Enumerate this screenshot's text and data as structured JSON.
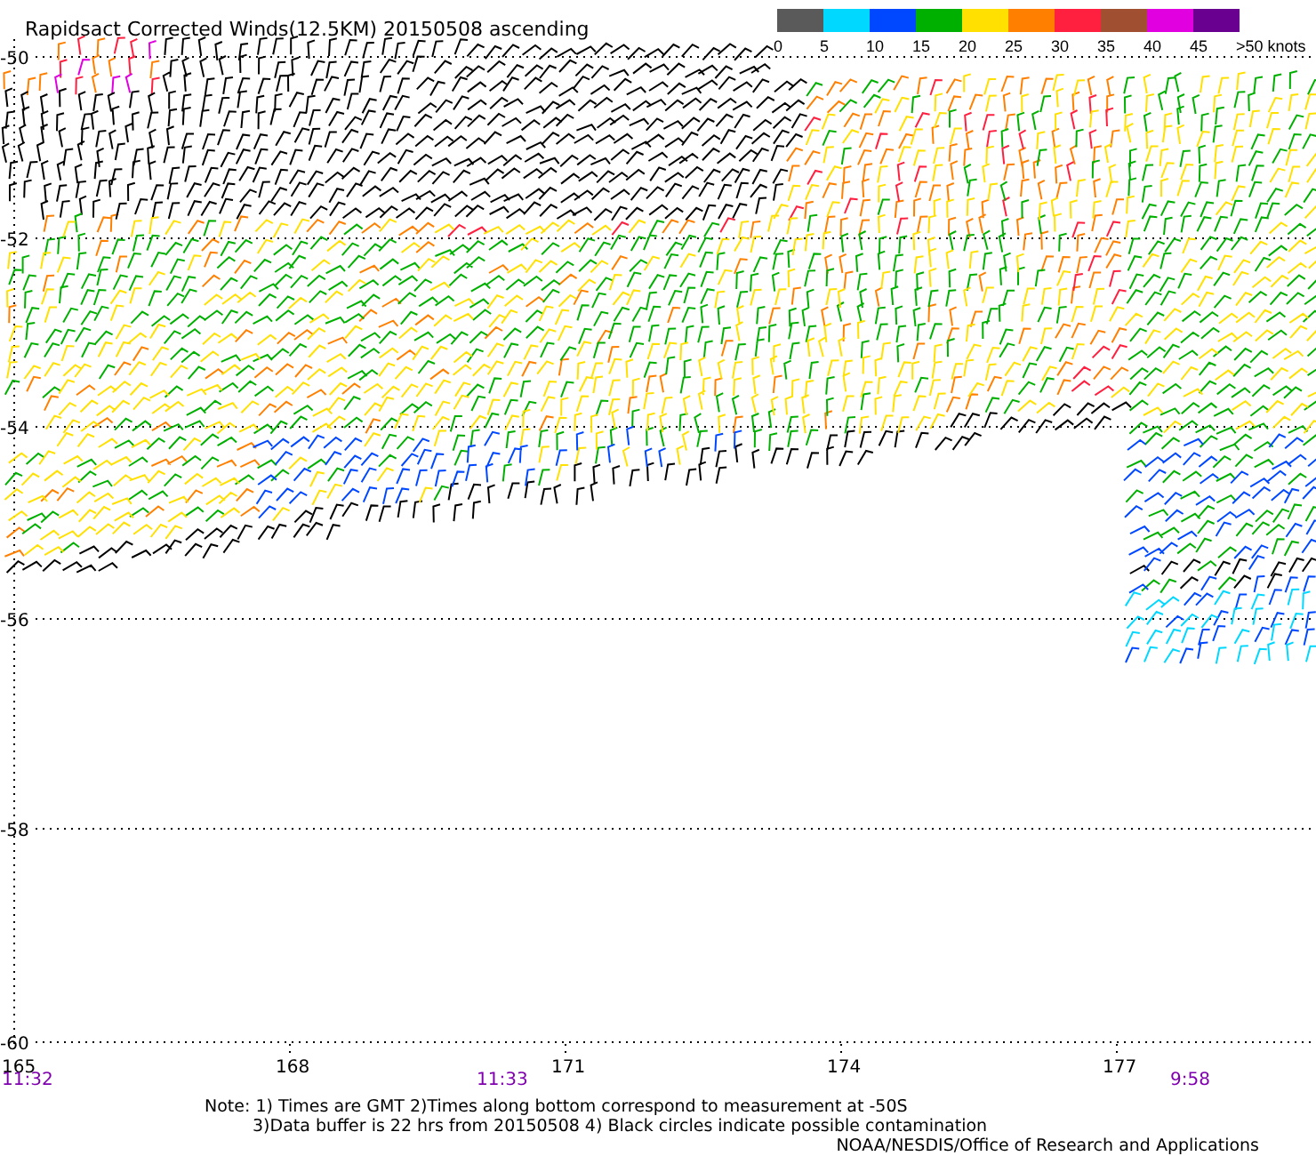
{
  "title": "Rapidsact Corrected Winds(12.5KM) 20150508 ascending",
  "legend": {
    "bands": [
      {
        "color": "#5a5a5a"
      },
      {
        "color": "#00d8ff"
      },
      {
        "color": "#0048ff"
      },
      {
        "color": "#00b000"
      },
      {
        "color": "#ffe000"
      },
      {
        "color": "#ff8000"
      },
      {
        "color": "#ff2040"
      },
      {
        "color": "#a05030"
      },
      {
        "color": "#e000e0"
      },
      {
        "color": "#6a0090"
      }
    ],
    "labels": [
      "0",
      "5",
      "10",
      "15",
      "20",
      "25",
      "30",
      "35",
      "40",
      "45",
      ">50 knots"
    ]
  },
  "map": {
    "lat_labels": [
      "-50",
      "-52",
      "-54",
      "-56",
      "-58",
      "-60"
    ],
    "lon_labels": [
      "165",
      "168",
      "171",
      "174",
      "177"
    ],
    "times": [
      "11:32",
      "11:33",
      "9:58"
    ]
  },
  "notes": [
    "Note: 1) Times are GMT 2)Times along bottom correspond to measurement at -50S",
    "3)Data buffer is 22 hrs from 20150508 4) Black circles indicate possible contamination"
  ],
  "credit": "NOAA/NESDIS/Office of Research and Applications"
}
